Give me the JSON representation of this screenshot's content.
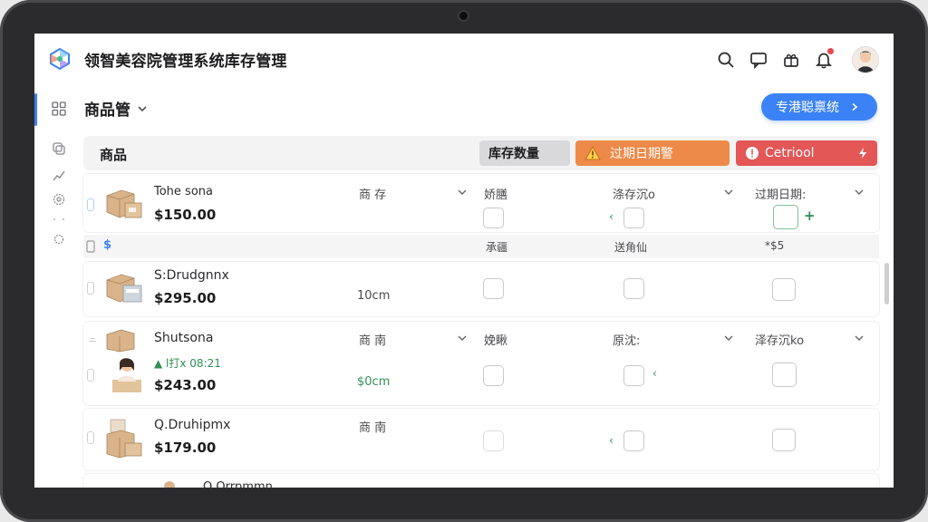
{
  "app": {
    "title": "领智美容院管理系统库存管理"
  },
  "header": {
    "icons": [
      "search-icon",
      "message-icon",
      "gift-icon",
      "bell-icon",
      "avatar"
    ]
  },
  "page": {
    "breadcrumb": "商品管",
    "action_button": "专港聪禀统"
  },
  "table": {
    "title": "商品",
    "col_qty": "库存数量",
    "col_expiry": "过期日期警",
    "col_control": "Cetriool"
  },
  "rows": [
    {
      "name": "Tohe sona",
      "price": "$150.00",
      "c1": "商 存",
      "c2": "娇膳",
      "c3": "涤存沉o",
      "c4": "过期日期:"
    },
    {
      "name": "S:Drudgnnx",
      "price": "$295.00",
      "c1": "10cm"
    },
    {
      "name": "Shutsona",
      "sub": "▲ l打x 08:21",
      "price": "$243.00",
      "c1": "商 南",
      "c1b": "$0cm",
      "c2": "娩瞅",
      "c3": "原沈:",
      "c4": "泽存沉ko"
    },
    {
      "name": "Q.Druhipmx",
      "price": "$179.00",
      "c1": "商 南"
    },
    {
      "name": "Q.Orrpmmn"
    }
  ],
  "subrow": {
    "dollar": "$",
    "a": "承疆",
    "b": "送角仙",
    "c": "*$5"
  },
  "colors": {
    "accent": "#3b82f6",
    "warning": "#ee8a49",
    "danger": "#e35757",
    "success": "#2f8f55"
  }
}
